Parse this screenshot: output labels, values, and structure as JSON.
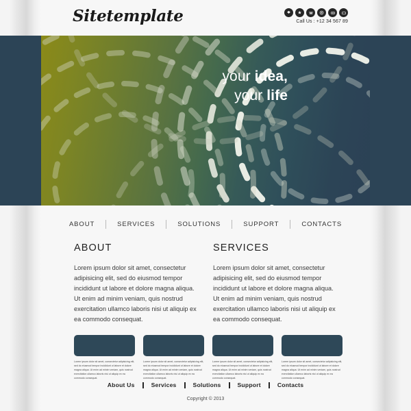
{
  "header": {
    "logo": "Sitetemplate",
    "call_us": "Call Us : +12 34 567 89",
    "social_icons": [
      {
        "name": "dropbox-icon",
        "glyph": "❖"
      },
      {
        "name": "flickr-icon",
        "glyph": "✸"
      },
      {
        "name": "wordpress-icon",
        "glyph": "W"
      },
      {
        "name": "skype-icon",
        "glyph": "✦"
      },
      {
        "name": "flickr-dots-icon",
        "glyph": "∞"
      },
      {
        "name": "youtube-icon",
        "glyph": "▭"
      }
    ]
  },
  "hero": {
    "line1_light": "your ",
    "line1_bold": "idea,",
    "line2_light": "your ",
    "line2_bold": "life",
    "gradient_start": "#8b8a18",
    "gradient_end": "#2b4155"
  },
  "nav": {
    "items": [
      {
        "label": "ABOUT"
      },
      {
        "label": "SERVICES"
      },
      {
        "label": "SOLUTIONS"
      },
      {
        "label": "SUPPORT"
      },
      {
        "label": "CONTACTS"
      }
    ]
  },
  "columns": [
    {
      "title": "ABOUT",
      "body": "Lorem ipsum dolor sit amet, consectetur adipisicing elit, sed do eiusmod tempor incididunt ut labore et dolore magna aliqua. Ut enim ad minim veniam, quis nostrud exercitation ullamco laboris nisi ut aliquip ex ea commodo consequat."
    },
    {
      "title": "SERVICES",
      "body": "Lorem ipsum dolor sit amet, consectetur adipisicing elit, sed do eiusmod tempor incididunt ut labore et dolore magna aliqua. Ut enim ad minim veniam, quis nostrud exercitation ullamco laboris nisi ut aliquip ex ea commodo consequat."
    }
  ],
  "cards": [
    {
      "text": "Lorem ipsum dolor sit amet, consectetur adipisicing elit, sed do eiusmod tempor incididunt ut labore et dolore magna aliqua. Ut enim ad minim veniam, quis nostrud exercitation ullamco laboris nisi ut aliquip ex ea commodo consequat."
    },
    {
      "text": "Lorem ipsum dolor sit amet, consectetur adipisicing elit, sed do eiusmod tempor incididunt ut labore et dolore magna aliqua. Ut enim ad minim veniam, quis nostrud exercitation ullamco laboris nisi ut aliquip ex ea commodo consequat."
    },
    {
      "text": "Lorem ipsum dolor sit amet, consectetur adipisicing elit, sed do eiusmod tempor incididunt ut labore et dolore magna aliqua. Ut enim ad minim veniam, quis nostrud exercitation ullamco laboris nisi ut aliquip ex ea commodo consequat."
    },
    {
      "text": "Lorem ipsum dolor sit amet, consectetur adipisicing elit, sed do eiusmod tempor incididunt ut labore et dolore magna aliqua. Ut enim ad minim veniam, quis nostrud exercitation ullamco laboris nisi ut aliquip ex ea commodo consequat."
    }
  ],
  "footer": {
    "items": [
      {
        "label": "About Us"
      },
      {
        "label": "Services"
      },
      {
        "label": "Solutions"
      },
      {
        "label": "Support"
      },
      {
        "label": "Contacts"
      }
    ],
    "copyright": "Copyright © 2013"
  },
  "theme": {
    "dark_slate": "#2c4456",
    "card_thumb": "#2e4858",
    "page_bg": "#f7f7f7"
  }
}
